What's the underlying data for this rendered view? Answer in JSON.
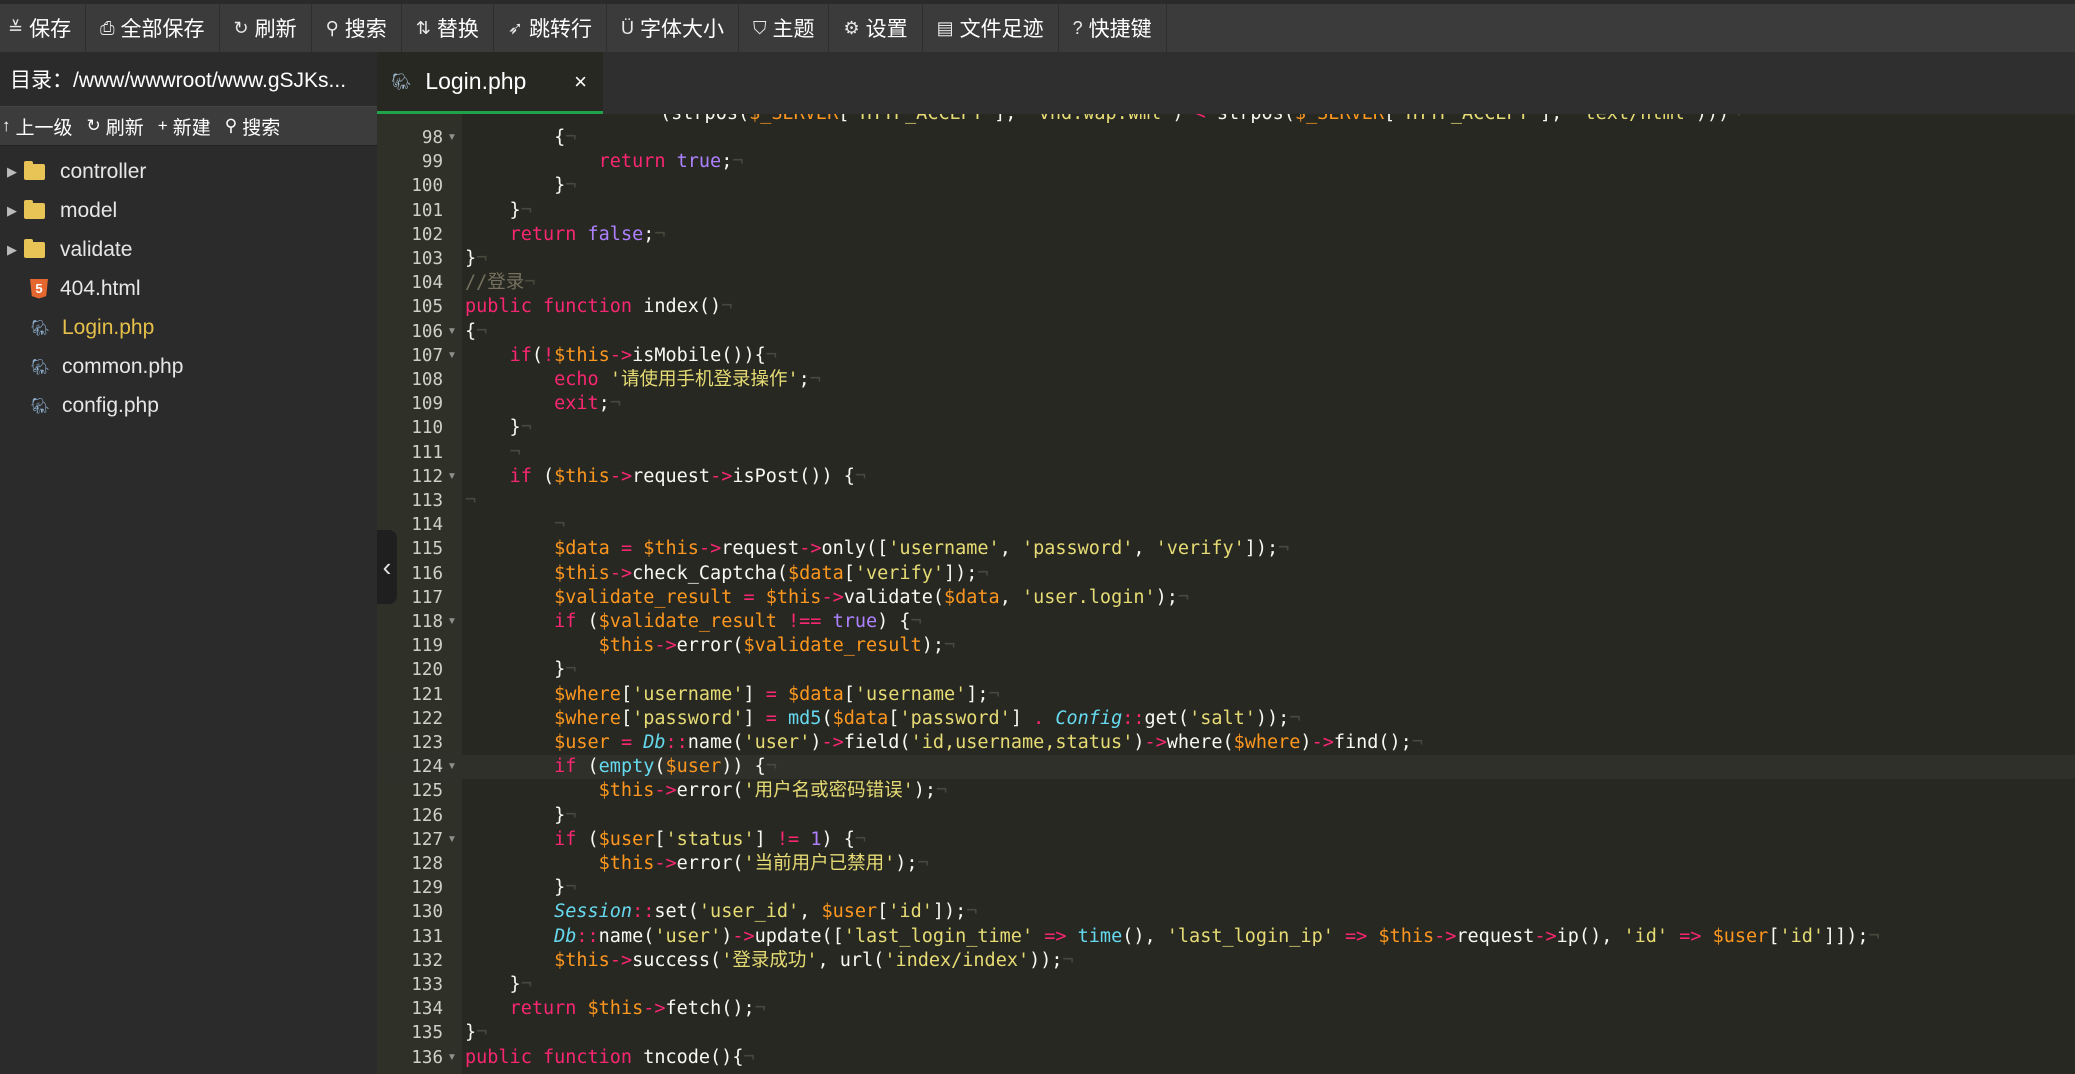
{
  "toolbar": {
    "buttons": [
      {
        "icon": "save-icon",
        "glyph": "≚",
        "label": "保存"
      },
      {
        "icon": "save-all-icon",
        "glyph": "⎙",
        "label": "全部保存"
      },
      {
        "icon": "refresh-icon",
        "glyph": "↻",
        "label": "刷新"
      },
      {
        "icon": "search-icon",
        "glyph": "⚲",
        "label": "搜索"
      },
      {
        "icon": "replace-icon",
        "glyph": "⇅",
        "label": "替换"
      },
      {
        "icon": "goto-line-icon",
        "glyph": "➶",
        "label": "跳转行"
      },
      {
        "icon": "font-size-icon",
        "glyph": "Ü",
        "label": "字体大小"
      },
      {
        "icon": "theme-icon",
        "glyph": "⛉",
        "label": "主题"
      },
      {
        "icon": "settings-icon",
        "glyph": "⚙",
        "label": "设置"
      },
      {
        "icon": "history-icon",
        "glyph": "▤",
        "label": "文件足迹"
      },
      {
        "icon": "help-icon",
        "glyph": "?",
        "label": "快捷键"
      }
    ]
  },
  "sidebar": {
    "path": "目录：/www/wwwroot/www.gSJKs...",
    "tools": [
      {
        "icon": "up-level-icon",
        "glyph": "↑",
        "label": "上一级"
      },
      {
        "icon": "refresh-icon",
        "glyph": "↻",
        "label": "刷新"
      },
      {
        "icon": "new-icon",
        "glyph": "+",
        "label": "新建"
      },
      {
        "icon": "search-icon",
        "glyph": "⚲",
        "label": "搜索"
      }
    ],
    "tree": [
      {
        "type": "folder",
        "name": "controller"
      },
      {
        "type": "folder",
        "name": "model"
      },
      {
        "type": "folder",
        "name": "validate"
      },
      {
        "type": "html",
        "name": "404.html",
        "badge": "5"
      },
      {
        "type": "php",
        "name": "Login.php",
        "active": true
      },
      {
        "type": "php",
        "name": "common.php"
      },
      {
        "type": "php",
        "name": "config.php"
      }
    ]
  },
  "editor": {
    "tab_label": "Login.php",
    "tab_close": "×",
    "first_line_fragment": "(strpos($_SERVER['HTTP_ACCEPT'], 'vnd.wap.wml') < strpos($_SERVER['HTTP_ACCEPT'], 'text/html')))",
    "lines": [
      {
        "n": "98",
        "code": "        {"
      },
      {
        "n": "99",
        "code": "            return true;"
      },
      {
        "n": "100",
        "code": "        }"
      },
      {
        "n": "101",
        "code": "    }"
      },
      {
        "n": "102",
        "code": "    return false;"
      },
      {
        "n": "103",
        "code": "}"
      },
      {
        "n": "104",
        "code": "//登录"
      },
      {
        "n": "105",
        "code": "public function index()"
      },
      {
        "n": "106",
        "code": "{"
      },
      {
        "n": "107",
        "code": "    if(!$this->isMobile()){"
      },
      {
        "n": "108",
        "code": "        echo '请使用手机登录操作';"
      },
      {
        "n": "109",
        "code": "        exit;"
      },
      {
        "n": "110",
        "code": "    }"
      },
      {
        "n": "111",
        "code": "    "
      },
      {
        "n": "112",
        "code": "    if ($this->request->isPost()) {"
      },
      {
        "n": "113",
        "code": ""
      },
      {
        "n": "114",
        "code": "        "
      },
      {
        "n": "115",
        "code": "        $data = $this->request->only(['username', 'password', 'verify']);"
      },
      {
        "n": "116",
        "code": "        $this->check_Captcha($data['verify']);"
      },
      {
        "n": "117",
        "code": "        $validate_result = $this->validate($data, 'user.login');"
      },
      {
        "n": "118",
        "code": "        if ($validate_result !== true) {"
      },
      {
        "n": "119",
        "code": "            $this->error($validate_result);"
      },
      {
        "n": "120",
        "code": "        }"
      },
      {
        "n": "121",
        "code": "        $where['username'] = $data['username'];"
      },
      {
        "n": "122",
        "code": "        $where['password'] = md5($data['password'] . Config::get('salt'));"
      },
      {
        "n": "123",
        "code": "        $user = Db::name('user')->field('id,username,status')->where($where)->find();"
      },
      {
        "n": "124",
        "code": "        if (empty($user)) {"
      },
      {
        "n": "125",
        "code": "            $this->error('用户名或密码错误');"
      },
      {
        "n": "126",
        "code": "        }"
      },
      {
        "n": "127",
        "code": "        if ($user['status'] != 1) {"
      },
      {
        "n": "128",
        "code": "            $this->error('当前用户已禁用');"
      },
      {
        "n": "129",
        "code": "        }"
      },
      {
        "n": "130",
        "code": "        Session::set('user_id', $user['id']);"
      },
      {
        "n": "131",
        "code": "        Db::name('user')->update(['last_login_time' => time(), 'last_login_ip' => $this->request->ip(), 'id' => $user['id']]);"
      },
      {
        "n": "132",
        "code": "        $this->success('登录成功', url('index/index'));"
      },
      {
        "n": "133",
        "code": "    }"
      },
      {
        "n": "134",
        "code": "    return $this->fetch();"
      },
      {
        "n": "135",
        "code": "}"
      },
      {
        "n": "136",
        "code": "public function tncode(){"
      }
    ],
    "fold_lines": [
      "98",
      "106",
      "107",
      "112",
      "118",
      "124",
      "127",
      "136"
    ],
    "current_line": "124"
  },
  "collapse_glyph": "‹",
  "colors": {
    "keyword": "#f92672",
    "variable": "#fd971f",
    "string": "#e6db74",
    "boolean": "#ae81ff",
    "comment": "#75715e",
    "function": "#66d9ef",
    "active_tab_border": "#21a34a",
    "active_file": "#e6c04a"
  }
}
